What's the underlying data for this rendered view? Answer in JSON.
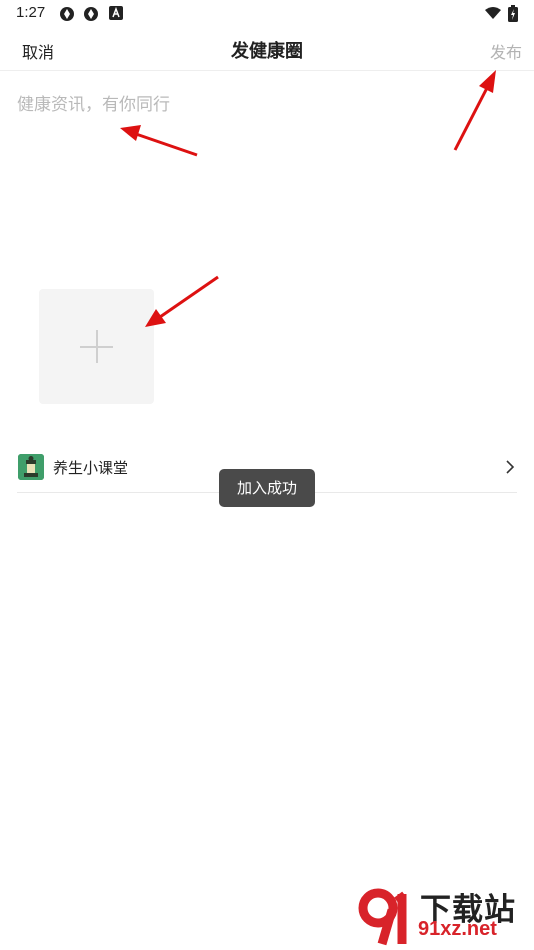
{
  "status_bar": {
    "time": "1:27",
    "icons": [
      "sync-icon",
      "sync-icon",
      "app-a-icon",
      "wifi-icon",
      "battery-charging-icon"
    ]
  },
  "header": {
    "cancel_label": "取消",
    "title": "发健康圈",
    "publish_label": "发布"
  },
  "composer": {
    "placeholder": "健康资讯，有你同行",
    "add_image_icon": "plus-icon"
  },
  "category": {
    "label": "养生小课堂",
    "icon": "category-thumbnail-icon",
    "chevron_icon": "chevron-right-icon"
  },
  "toast": {
    "text": "加入成功"
  },
  "watermark": {
    "top": "下载站",
    "bottom": "91xz.net"
  },
  "colors": {
    "annotation_arrow": "#dd1111",
    "publish_disabled": "#b3b3b3",
    "toast_bg": "#4a4a4a",
    "watermark_red": "#d8232a"
  }
}
